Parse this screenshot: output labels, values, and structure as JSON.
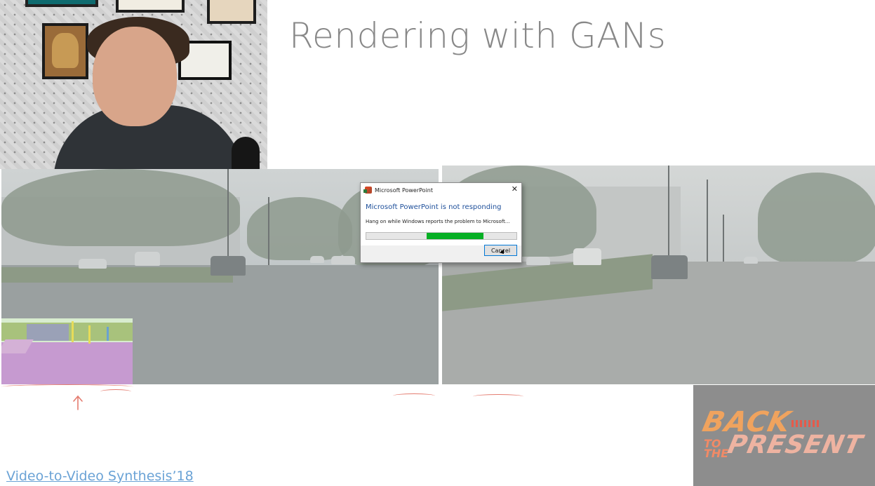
{
  "slide": {
    "title": "Rendering with GANs",
    "caption_link": "Video-to-Video Synthesis’18"
  },
  "dialog": {
    "window_title": "Microsoft PowerPoint",
    "headline": "Microsoft PowerPoint is not responding",
    "detail": "Hang on while Windows reports the problem to Microsoft...",
    "close_glyph": "✕",
    "cancel_label": "Cancel",
    "progress": {
      "start_fraction": 0.4,
      "end_fraction": 0.78,
      "color": "#06b025"
    }
  },
  "logo": {
    "line1": "BACK",
    "line2_small": "TO THE",
    "line2": "PRESENT"
  },
  "colors": {
    "title": "#888888",
    "link": "#6ba3d6",
    "annotation": "#e47c70",
    "dialog_headline": "#1e4f9a"
  }
}
